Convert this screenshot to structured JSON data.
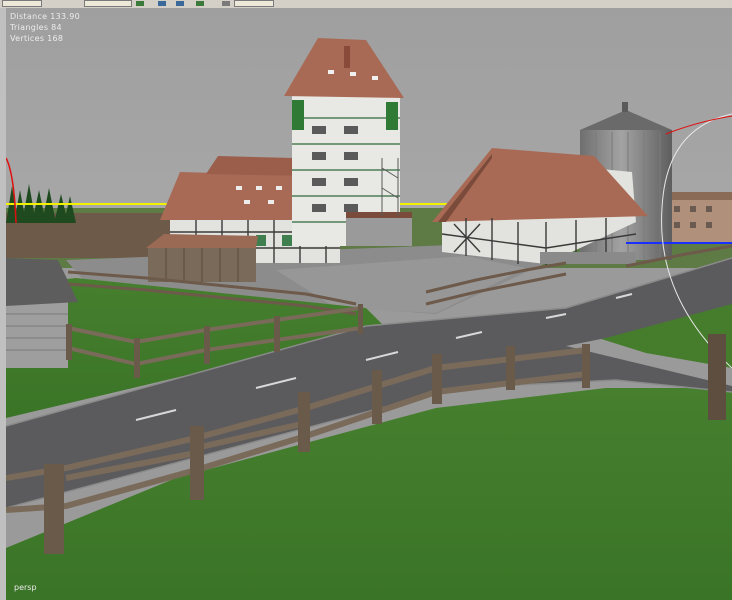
{
  "app": {
    "toolbar": {
      "buttons": [
        {
          "icon": "select-tool-icon"
        },
        {
          "icon": "move-tool-icon"
        },
        {
          "icon": "rotate-tool-icon"
        },
        {
          "icon": "scale-tool-icon"
        },
        {
          "icon": "camera-tool-icon"
        },
        {
          "icon": "snap-tool-icon"
        }
      ]
    }
  },
  "viewport": {
    "stats": [
      {
        "label": "Distance",
        "value": "133.90"
      },
      {
        "label": "Triangles",
        "value": "84"
      },
      {
        "label": "Vertices",
        "value": "168"
      }
    ],
    "stat_text": [
      "Distance 133.90",
      "Triangles 84",
      "Vertices 168"
    ],
    "camera_label": "persp",
    "colors": {
      "sky": "#a3a3a3",
      "grass": "#3f7a2a",
      "road": "#5b5b5d",
      "roof": "#a86a55",
      "wall": "#e8e8e4",
      "timber": "#3a3a3a",
      "silo": "#8b8b8b",
      "fence": "#6d5a4a",
      "axis_yellow": "#f2f200",
      "axis_red": "#e01010",
      "axis_blue": "#1a30ff"
    }
  }
}
